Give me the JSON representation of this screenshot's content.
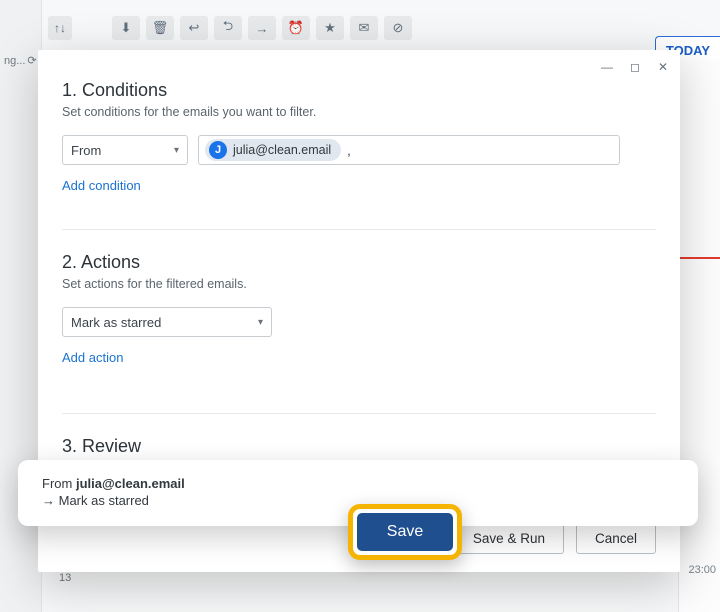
{
  "bg": {
    "today_label": "TODAY",
    "sync_label": "ng...",
    "time_label": "23:00",
    "date_label": "13",
    "toolbar_icons": [
      "download-icon",
      "trash-icon",
      "reply-icon",
      "reply-all-icon",
      "forward-icon",
      "clock-icon",
      "star-icon",
      "mail-icon",
      "block-icon"
    ],
    "sort_icon": "sort-icon"
  },
  "modal": {
    "window": {
      "min": "min",
      "max": "max",
      "close": "close"
    },
    "conditions": {
      "title": "1. Conditions",
      "subtitle": "Set conditions for the emails you want to filter.",
      "select_label": "From",
      "chip": {
        "initial": "J",
        "email": "julia@clean.email"
      },
      "comma": ",",
      "add_link": "Add condition"
    },
    "actions": {
      "title": "2. Actions",
      "subtitle": "Set actions for the filtered emails.",
      "select_label": "Mark as starred",
      "add_link": "Add action"
    },
    "review": {
      "title": "3. Review",
      "line1_prefix": "From ",
      "line1_bold": "julia@clean.email",
      "line2": "→  Mark as starred"
    },
    "footer": {
      "save": "Save",
      "save_run": "Save & Run",
      "cancel": "Cancel"
    }
  }
}
